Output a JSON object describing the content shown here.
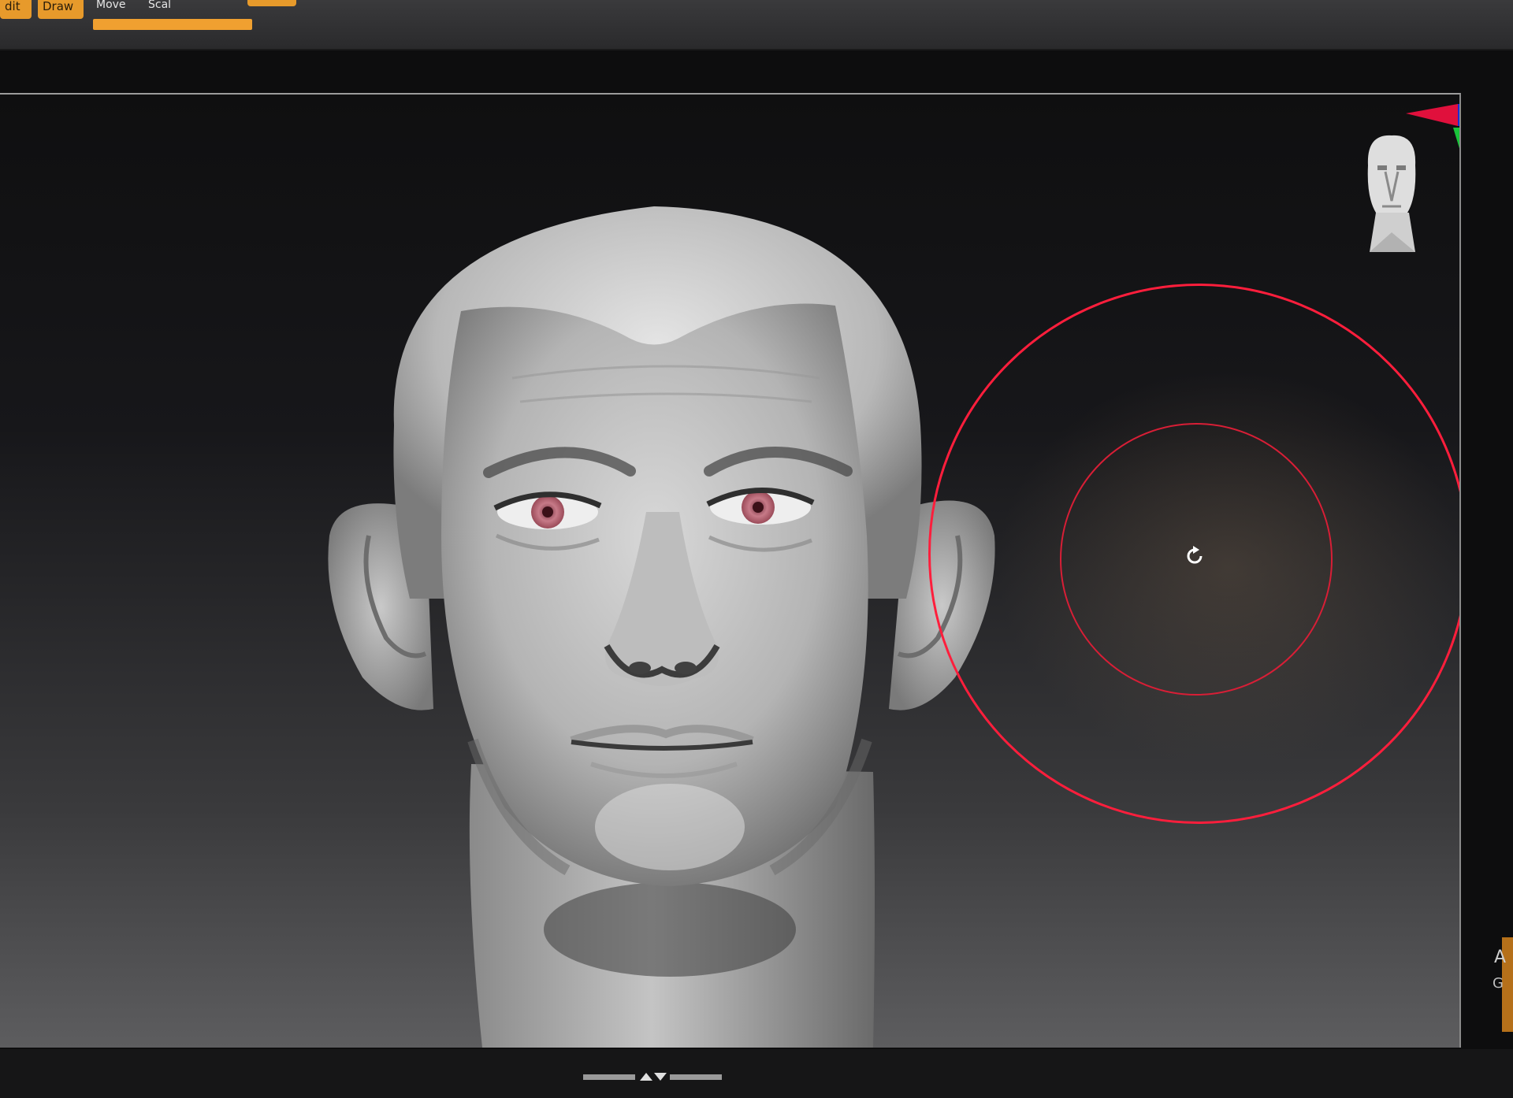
{
  "toolbar": {
    "buttons": [
      {
        "label": "dit",
        "active": true
      },
      {
        "label": "Draw",
        "active": true
      }
    ],
    "labels": [
      {
        "label": "Move"
      },
      {
        "label": "Scal"
      }
    ]
  },
  "viewport": {
    "model": "sculpted-male-head",
    "nav_gizmo": "head-navigation-icon",
    "axis_gizmo": "xyz-axis-icon",
    "brush_cursor": "rotate-icon",
    "brush_color": "#ff1e3c"
  },
  "side_panel": {
    "label_1": "A",
    "label_2": "G"
  },
  "colors": {
    "accent": "#e79a2b",
    "brush": "#ff1e3c",
    "background": "#0d0d0e"
  }
}
